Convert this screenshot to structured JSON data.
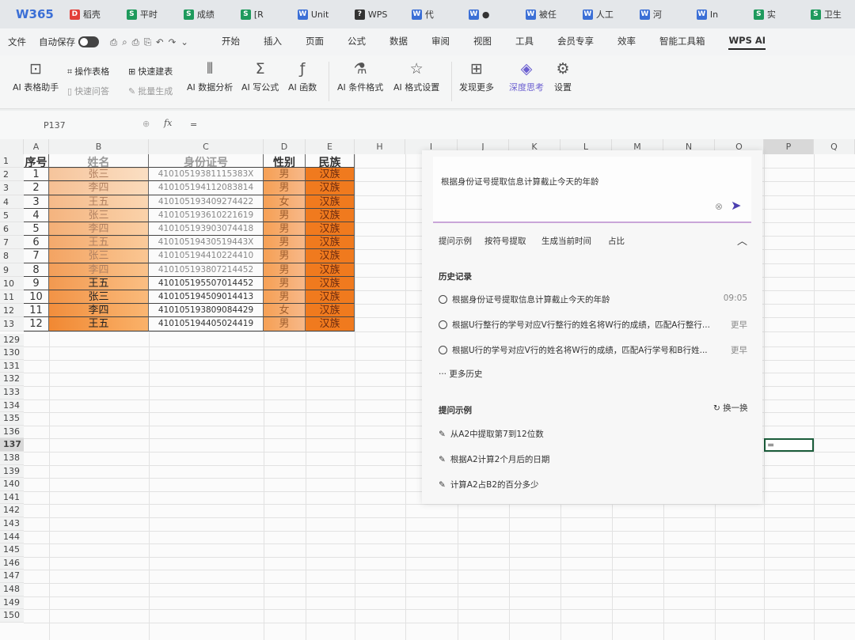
{
  "app": {
    "logo": "W365"
  },
  "tabs": [
    {
      "icon": "D",
      "color": "#e3403a",
      "label": "稻壳"
    },
    {
      "icon": "S",
      "color": "#1e9a5c",
      "label": "平时"
    },
    {
      "icon": "S",
      "color": "#1e9a5c",
      "label": "成绩"
    },
    {
      "icon": "S",
      "color": "#1e9a5c",
      "label": "[R"
    },
    {
      "icon": "W",
      "color": "#3b6fd6",
      "label": "Unit"
    },
    {
      "icon": "?",
      "color": "#333",
      "label": "WPS"
    },
    {
      "icon": "W",
      "color": "#3b6fd6",
      "label": "代"
    },
    {
      "icon": "W",
      "color": "#3b6fd6",
      "label": "●"
    },
    {
      "icon": "W",
      "color": "#3b6fd6",
      "label": "被任"
    },
    {
      "icon": "W",
      "color": "#3b6fd6",
      "label": "人工"
    },
    {
      "icon": "W",
      "color": "#3b6fd6",
      "label": "河"
    },
    {
      "icon": "W",
      "color": "#3b6fd6",
      "label": "In"
    },
    {
      "icon": "S",
      "color": "#1e9a5c",
      "label": "实"
    },
    {
      "icon": "S",
      "color": "#1e9a5c",
      "label": "卫生"
    }
  ],
  "menubar": {
    "file": "文件",
    "autosave": "自动保存",
    "items": [
      "开始",
      "插入",
      "页面",
      "公式",
      "数据",
      "审阅",
      "视图",
      "工具",
      "会员专享",
      "效率",
      "智能工具箱",
      "WPS AI"
    ],
    "active": "WPS AI"
  },
  "ribbon": {
    "items": [
      {
        "icon": "chat-icon",
        "glyph": "⊡",
        "label": "AI 表格助手"
      },
      {
        "icon": "table-op-icon",
        "glyph": "⌗",
        "label": "操作表格"
      },
      {
        "icon": "quick-ask-icon",
        "glyph": "▯",
        "label": "快速问答"
      },
      {
        "icon": "quick-table-icon",
        "glyph": "⊞",
        "label": "快速建表"
      },
      {
        "icon": "batch-icon",
        "glyph": "✎",
        "label": "批量生成"
      },
      {
        "icon": "data-analysis-icon",
        "glyph": "⫴",
        "label": "AI 数据分析"
      },
      {
        "icon": "sigma-icon",
        "glyph": "Σ",
        "label": "AI 写公式"
      },
      {
        "icon": "function-icon",
        "glyph": "ƒ",
        "label": "AI 函数"
      },
      {
        "icon": "condition-format-icon",
        "glyph": "⚗",
        "label": "AI 条件格式"
      },
      {
        "icon": "format-settings-icon",
        "glyph": "☆",
        "label": "AI 格式设置"
      },
      {
        "icon": "discover-icon",
        "glyph": "⊞",
        "label": "发现更多"
      },
      {
        "icon": "deep-think-icon",
        "glyph": "◈",
        "label": "深度思考"
      },
      {
        "icon": "gear-icon",
        "glyph": "⚙",
        "label": "设置"
      }
    ]
  },
  "formula_bar": {
    "cell_ref": "P137",
    "fx": "fx",
    "value": "="
  },
  "columns": [
    "A",
    "B",
    "C",
    "D",
    "E",
    "H",
    "I",
    "J",
    "K",
    "L",
    "M",
    "N",
    "O",
    "P",
    "Q"
  ],
  "rows_top": [
    "1",
    "2",
    "3",
    "4",
    "5",
    "6",
    "7",
    "8",
    "9",
    "10",
    "11",
    "12",
    "13"
  ],
  "rows_bottom": [
    "129",
    "130",
    "131",
    "132",
    "133",
    "134",
    "135",
    "136",
    "137",
    "138",
    "139",
    "140",
    "141",
    "142",
    "143",
    "144",
    "145",
    "146",
    "147",
    "148",
    "149",
    "150"
  ],
  "table": {
    "headers": [
      "序号",
      "姓名",
      "身份证号",
      "性别",
      "民族"
    ],
    "rows": [
      [
        "1",
        "张三",
        "41010519381115383X",
        "男",
        "汉族"
      ],
      [
        "2",
        "李四",
        "410105194112083814",
        "男",
        "汉族"
      ],
      [
        "3",
        "王五",
        "410105193409274422",
        "女",
        "汉族"
      ],
      [
        "4",
        "张三",
        "410105193610221619",
        "男",
        "汉族"
      ],
      [
        "5",
        "李四",
        "410105193903074418",
        "男",
        "汉族"
      ],
      [
        "6",
        "王五",
        "41010519430519443X",
        "男",
        "汉族"
      ],
      [
        "7",
        "张三",
        "410105194410224410",
        "男",
        "汉族"
      ],
      [
        "8",
        "李四",
        "410105193807214452",
        "男",
        "汉族"
      ],
      [
        "9",
        "王五",
        "410105195507014452",
        "男",
        "汉族"
      ],
      [
        "10",
        "张三",
        "410105194509014413",
        "男",
        "汉族"
      ],
      [
        "11",
        "李四",
        "410105193809084429",
        "女",
        "汉族"
      ],
      [
        "12",
        "王五",
        "410105194405024419",
        "男",
        "汉族"
      ]
    ]
  },
  "active_cell": {
    "value": "="
  },
  "ai_panel": {
    "input": "根据身份证号提取信息计算截止今天的年龄",
    "chips": [
      "提问示例",
      "按符号提取",
      "生成当前时间",
      "占比"
    ],
    "history_title": "历史记录",
    "history": [
      {
        "text": "根据身份证号提取信息计算截止今天的年龄",
        "time": "09:05"
      },
      {
        "text": "根据U行整行的学号对应V行整行的姓名将W行的成绩，匹配A行整行...",
        "time": "更早"
      },
      {
        "text": "根据U行的学号对应V行的姓名将W行的成绩，匹配A行学号和B行姓...",
        "time": "更早"
      }
    ],
    "more_history": "··· 更多历史",
    "examples_title": "提问示例",
    "refresh": "换一换",
    "examples": [
      "从A2中提取第7到12位数",
      "根据A2计算2个月后的日期",
      "计算A2占B2的百分多少"
    ]
  },
  "colors": {
    "accent": "#4b3fb0",
    "orange": "#f07a1e"
  }
}
